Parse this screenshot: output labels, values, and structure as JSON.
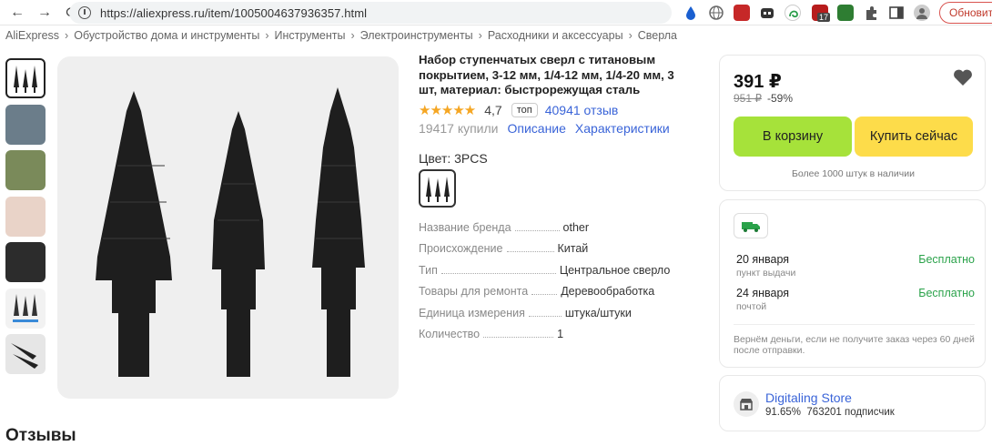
{
  "browser": {
    "url": "https://aliexpress.ru/item/1005004637936357.html",
    "update_label": "Обновить",
    "ext_badge": "17"
  },
  "breadcrumbs": [
    "AliExpress",
    "Обустройство дома и инструменты",
    "Инструменты",
    "Электроинструменты",
    "Расходники и аксессуары",
    "Сверла"
  ],
  "product": {
    "title": "Набор ступенчатых сверл с титановым покрытием, 3-12 мм, 1/4-12 мм, 1/4-20 мм, 3 шт, материал: быстрорежущая сталь",
    "stars": "★★★★★",
    "rating": "4,7",
    "rating_fraction": 0.94,
    "top_badge": "топ",
    "reviews": "40941 отзыв",
    "sold": "19417 купили",
    "description_link": "Описание",
    "specs_link": "Характеристики",
    "color_label": "Цвет: 3PCS"
  },
  "specs": [
    {
      "key": "Название бренда",
      "value": "other"
    },
    {
      "key": "Происхождение",
      "value": "Китай"
    },
    {
      "key": "Тип",
      "value": "Центральное сверло"
    },
    {
      "key": "Товары для ремонта",
      "value": "Деревообработка"
    },
    {
      "key": "Единица измерения",
      "value": "штука/штуки"
    },
    {
      "key": "Количество",
      "value": "1"
    }
  ],
  "purchase": {
    "price": "391 ₽",
    "old_price": "951 ₽",
    "discount": "-59%",
    "cart_label": "В корзину",
    "buy_label": "Купить сейчас",
    "stock": "Более 1000 штук в наличии"
  },
  "delivery": {
    "options": [
      {
        "date": "20 января",
        "method": "пункт выдачи",
        "price": "Бесплатно"
      },
      {
        "date": "24 января",
        "method": "почтой",
        "price": "Бесплатно"
      }
    ],
    "refund": "Вернём деньги, если не получите заказ через 60 дней после отправки."
  },
  "store": {
    "name": "Digitaling Store",
    "rating": "91.65%",
    "subscribers": "763201 подписчик"
  },
  "reviews_heading": "Отзывы",
  "colors": {
    "link": "#3a64d8",
    "cart_button": "#a6e23a",
    "buy_button": "#fddc4a",
    "free": "#2aa24a",
    "star": "#f5a623"
  }
}
